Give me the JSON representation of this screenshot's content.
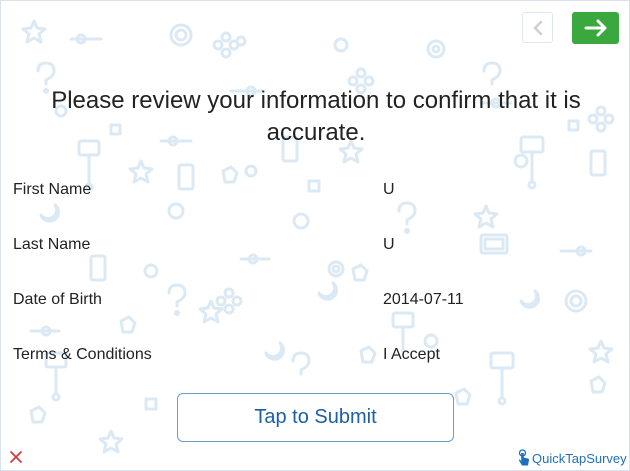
{
  "survey": {
    "heading": "Please review your information to confirm that it is accurate.",
    "fields": [
      {
        "label": "First Name",
        "value": "U"
      },
      {
        "label": "Last Name",
        "value": "U"
      },
      {
        "label": "Date of Birth",
        "value": "2014-07-11"
      },
      {
        "label": "Terms & Conditions",
        "value": "I Accept"
      }
    ],
    "submit_label": "Tap to Submit"
  },
  "nav": {
    "back_icon": "chevron-left-icon",
    "next_icon": "arrow-right-icon"
  },
  "footer": {
    "close_icon": "close-icon",
    "brand_name": "QuickTapSurvey"
  },
  "colors": {
    "accent_green": "#3aa83e",
    "submit_text": "#1c5fa6",
    "brand_blue": "#1e6fc2",
    "close_red": "#d43a3a",
    "pattern": "#dbe9f4"
  }
}
